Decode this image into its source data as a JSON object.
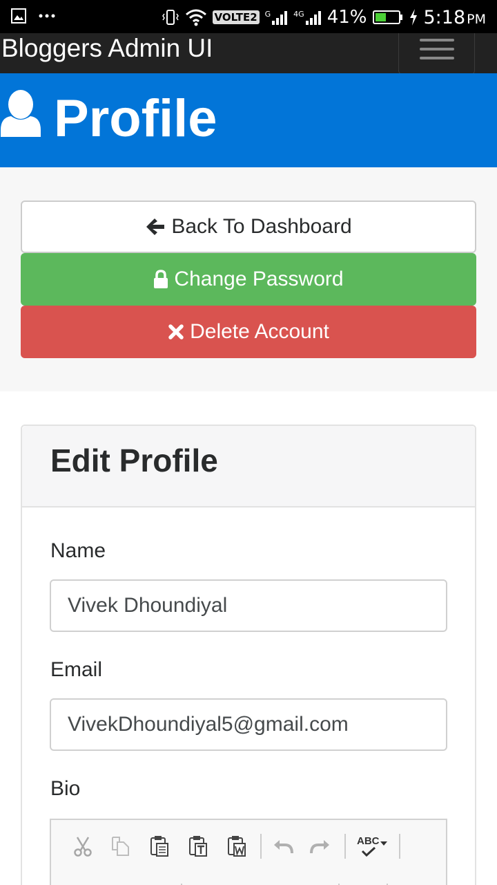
{
  "status_bar": {
    "volte_label": "VOLTE2",
    "sim1_label": "G",
    "sim2_label": "4G",
    "battery_percent": "41%",
    "time": "5:18",
    "ampm": "PM"
  },
  "navbar": {
    "brand": "Bloggers Admin UI"
  },
  "header": {
    "title": "Profile"
  },
  "actions": {
    "back_label": "Back To Dashboard",
    "change_password_label": "Change Password",
    "delete_label": "Delete Account"
  },
  "form": {
    "title": "Edit Profile",
    "name_label": "Name",
    "name_value": "Vivek Dhoundiyal",
    "email_label": "Email",
    "email_value": "VivekDhoundiyal5@gmail.com",
    "bio_label": "Bio"
  },
  "editor": {
    "spellcheck_label": "ABC",
    "toolbar_icons": [
      "cut-icon",
      "copy-icon",
      "paste-icon",
      "paste-text-icon",
      "paste-word-icon",
      "undo-icon",
      "redo-icon",
      "spellcheck-icon"
    ]
  },
  "colors": {
    "navbar": "#222222",
    "primary": "#0275d8",
    "success": "#5cb85c",
    "danger": "#d9534f"
  }
}
